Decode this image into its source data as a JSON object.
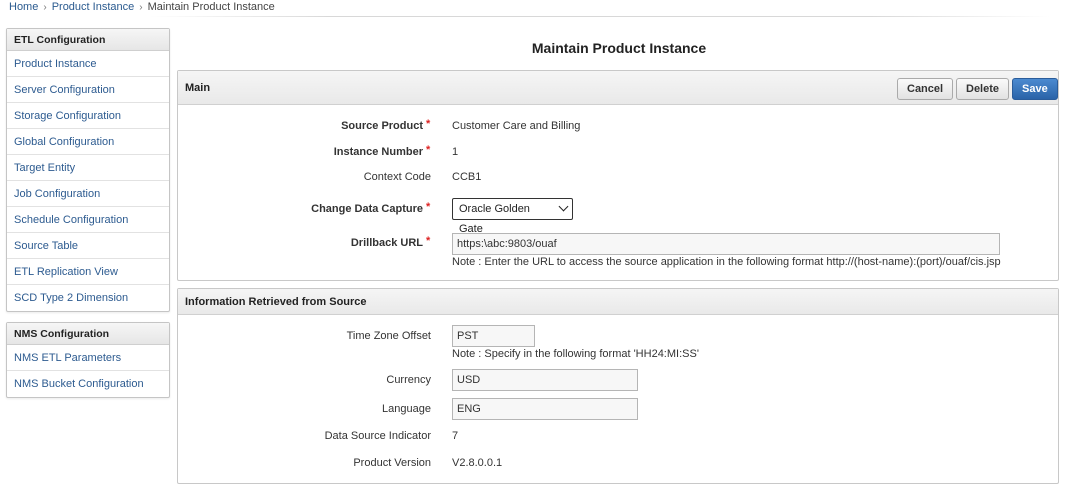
{
  "breadcrumb": {
    "home": "Home",
    "level1": "Product Instance",
    "current": "Maintain Product Instance",
    "separator": "›"
  },
  "sidebar": {
    "etl_title": "ETL Configuration",
    "etl_items": [
      {
        "label": "Product Instance"
      },
      {
        "label": "Server Configuration"
      },
      {
        "label": "Storage Configuration"
      },
      {
        "label": "Global Configuration"
      },
      {
        "label": "Target Entity"
      },
      {
        "label": "Job Configuration"
      },
      {
        "label": "Schedule Configuration"
      },
      {
        "label": "Source Table"
      },
      {
        "label": "ETL Replication View"
      },
      {
        "label": "SCD Type 2 Dimension"
      }
    ],
    "nms_title": "NMS Configuration",
    "nms_items": [
      {
        "label": "NMS ETL Parameters"
      },
      {
        "label": "NMS Bucket Configuration"
      }
    ]
  },
  "page_title": "Maintain Product Instance",
  "main": {
    "title": "Main",
    "buttons": {
      "cancel": "Cancel",
      "delete": "Delete",
      "save": "Save"
    },
    "required_marker": "*",
    "source_product": {
      "label": "Source Product",
      "value": "Customer Care and Billing"
    },
    "instance_number": {
      "label": "Instance Number",
      "value": "1"
    },
    "context_code": {
      "label": "Context Code",
      "value": "CCB1"
    },
    "change_data_capture": {
      "label": "Change Data Capture",
      "value": "Oracle Golden Gate"
    },
    "drillback_url": {
      "label": "Drillback URL",
      "value": "https:\\abc:9803/ouaf",
      "note": "Note : Enter the URL to access the source application in the following format http://(host-name):(port)/ouaf/cis.jsp"
    }
  },
  "info": {
    "title": "Information Retrieved from Source",
    "time_zone_offset": {
      "label": "Time Zone Offset",
      "value": "PST",
      "note": "Note : Specify in the following format 'HH24:MI:SS'"
    },
    "currency": {
      "label": "Currency",
      "value": "USD"
    },
    "language": {
      "label": "Language",
      "value": "ENG"
    },
    "data_source_indicator": {
      "label": "Data Source Indicator",
      "value": "7"
    },
    "product_version": {
      "label": "Product Version",
      "value": "V2.8.0.0.1"
    }
  },
  "colors": {
    "link": "#2d5b90",
    "required": "#dd2222",
    "save_button": "#2a63a8"
  }
}
